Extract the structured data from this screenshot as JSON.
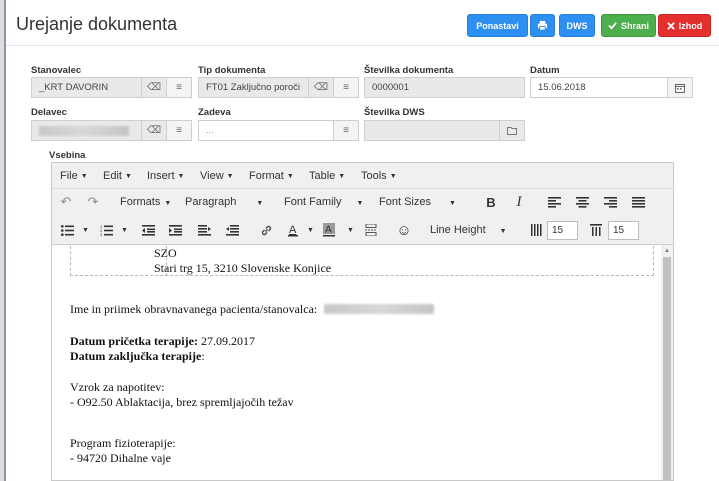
{
  "header": {
    "title": "Urejanje dokumenta",
    "buttons": {
      "reset": "Ponastavi",
      "dws": "DWS",
      "save": "Shrani",
      "exit": "Izhod"
    }
  },
  "form": {
    "resident": {
      "label": "Stanovalec",
      "value": "_KRT DAVORIN"
    },
    "doc_type": {
      "label": "Tip dokumenta",
      "value": "FT01 Zaključno poroči"
    },
    "doc_number": {
      "label": "Številka dokumenta",
      "value": "0000001"
    },
    "date": {
      "label": "Datum",
      "value": "15.06.2018"
    },
    "worker": {
      "label": "Delavec",
      "value": ""
    },
    "subject": {
      "label": "Zadeva",
      "value": "..."
    },
    "dws_number": {
      "label": "Številka DWS",
      "value": ""
    },
    "content_label": "Vsebina"
  },
  "editor": {
    "menu": [
      "File",
      "Edit",
      "Insert",
      "View",
      "Format",
      "Table",
      "Tools"
    ],
    "toolbar": {
      "formats": "Formats",
      "paragraph": "Paragraph",
      "font_family": "Font Family",
      "font_sizes": "Font Sizes",
      "line_height": "Line Height",
      "input_a": "15",
      "input_b": "15"
    },
    "content": {
      "org": "SZO",
      "address": "Stari trg 15, 3210 Slovenske Konjice",
      "patient_label": "Ime in priimek obravnavanega pacienta/stanovalca:",
      "start_label": "Datum pričetka terapije:",
      "start_value": " 27.09.2017",
      "end_label": "Datum zaključka terapije",
      "end_suffix": ":",
      "referral_label": "Vzrok za napotitev:",
      "referral_value": "- O92.50 Ablaktacija, brez spremljajočih težav",
      "program_label": "Program fizioterapije:",
      "program_value": "- 94720 Dihalne vaje"
    }
  },
  "colors": {
    "primary": "#2d8ff0",
    "success": "#4cae4c",
    "danger": "#e42f2f"
  },
  "icons": [
    "print-icon",
    "check-icon",
    "close-icon",
    "eraser-icon",
    "list-icon",
    "calendar-icon",
    "folder-icon"
  ]
}
